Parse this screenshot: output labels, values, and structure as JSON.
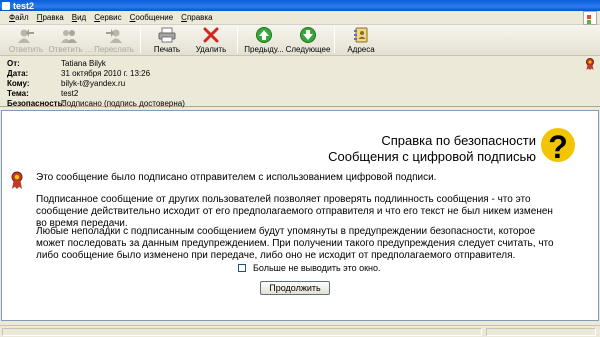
{
  "window": {
    "title": "test2"
  },
  "menu": {
    "items": [
      {
        "label": "Файл",
        "key": "Ф",
        "rest": "айл"
      },
      {
        "label": "Правка",
        "key": "П",
        "rest": "равка"
      },
      {
        "label": "Вид",
        "key": "В",
        "rest": "ид"
      },
      {
        "label": "Сервис",
        "key": "С",
        "rest": "ервис"
      },
      {
        "label": "Сообщение",
        "key": "С",
        "rest": "ообщение"
      },
      {
        "label": "Справка",
        "key": "С",
        "rest": "правка"
      }
    ]
  },
  "toolbar": {
    "reply": "Ответить",
    "reply_all": "Ответить ...",
    "forward": "Переслать",
    "print": "Печать",
    "delete": "Удалить",
    "previous": "Предыду...",
    "next": "Следующее",
    "addresses": "Адреса"
  },
  "header": {
    "from_label": "От:",
    "from_value": "Tatiana Bilyk",
    "date_label": "Дата:",
    "date_value": "31 октября 2010 г. 13:26",
    "to_label": "Кому:",
    "to_value": "bilyk-t@yandex.ru",
    "subject_label": "Тема:",
    "subject_value": "test2",
    "security_label": "Безопасность:",
    "security_value": "Подписано (подпись достоверна)"
  },
  "help": {
    "title_line1": "Справка по безопасности",
    "title_line2": "Сообщения с цифровой подписью",
    "intro": "Это сообщение было подписано отправителем с использованием цифровой подписи.",
    "para1": "Подписанное сообщение от других пользователей позволяет проверять подлинность сообщения - что это сообщение действительно исходит от его предполагаемого отправителя и что его текст не был никем изменен во время передачи.",
    "para2": "Любые неполадки с подписанным сообщением будут упомянуты в предупреждении безопасности, которое может последовать за данным предупреждением. При получении такого предупреждения следует считать, что либо сообщение было изменено при передаче, либо оно не исходит от предполагаемого отправителя.",
    "checkbox_label": "Больше не выводить это окно.",
    "checkbox_checked": false,
    "continue_button": "Продолжить"
  },
  "colors": {
    "titlebar": "#0a5fd6",
    "pane_border": "#7f9db9",
    "accent_red": "#c0392b",
    "accent_yellow": "#f2c500"
  }
}
